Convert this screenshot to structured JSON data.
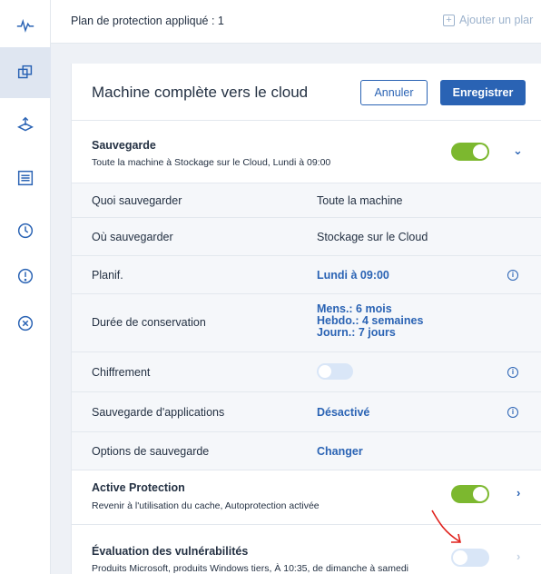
{
  "sidebar": {
    "items": [
      {
        "name": "activity-icon"
      },
      {
        "name": "devices-icon",
        "active": true
      },
      {
        "name": "backup-storage-icon"
      },
      {
        "name": "reports-icon"
      },
      {
        "name": "history-icon"
      },
      {
        "name": "alert-icon"
      },
      {
        "name": "close-circle-icon"
      }
    ]
  },
  "topbar": {
    "plan_applied": "Plan de protection appliqué : 1",
    "add_plan": "Ajouter un plar"
  },
  "panel": {
    "title": "Machine complète vers le cloud",
    "cancel_label": "Annuler",
    "save_label": "Enregistrer"
  },
  "backup": {
    "title": "Sauvegarde",
    "subtitle": "Toute la machine à Stockage sur le Cloud, Lundi à 09:00",
    "enabled": true,
    "rows": [
      {
        "label": "Quoi sauvegarder",
        "value": "Toute la machine"
      },
      {
        "label": "Où sauvegarder",
        "value": "Stockage sur le Cloud"
      },
      {
        "label": "Planif.",
        "value": "Lundi à 09:00"
      },
      {
        "label": "Durée de conservation",
        "value_lines": [
          "Mens.: 6 mois",
          "Hebdo.: 4 semaines",
          "Journ.: 7 jours"
        ]
      },
      {
        "label": "Chiffrement",
        "value": ""
      },
      {
        "label": "Sauvegarde d'applications",
        "value": "Désactivé"
      },
      {
        "label": "Options de sauvegarde",
        "value": "Changer"
      }
    ]
  },
  "active_protection": {
    "title": "Active Protection",
    "subtitle": "Revenir à l'utilisation du cache, Autoprotection activée",
    "enabled": true
  },
  "vulnerability": {
    "title": "Évaluation des vulnérabilités",
    "subtitle": "Produits Microsoft, produits Windows tiers, À 10:35, de dimanche à samedi",
    "enabled": false
  },
  "colors": {
    "accent": "#2a63b4",
    "toggle_on": "#7cb82f",
    "toggle_off": "#d9e6f7",
    "annotation": "#e0201b"
  }
}
